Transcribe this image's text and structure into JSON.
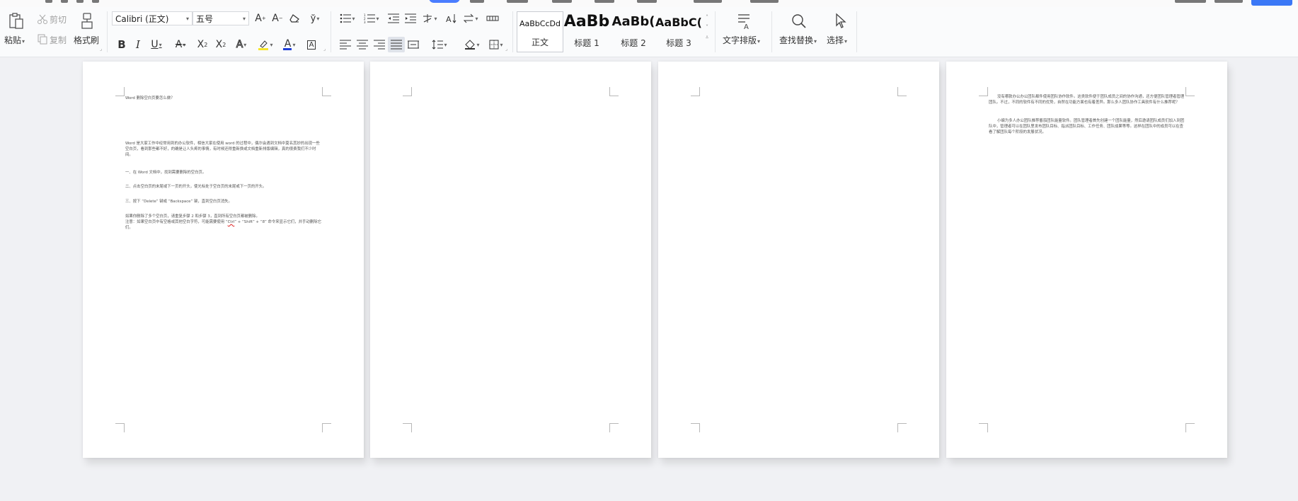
{
  "ribbon": {
    "clipboard": {
      "paste": "粘贴",
      "cut": "剪切",
      "copy": "复制",
      "format_painter": "格式刷"
    },
    "font": {
      "family": "Calibri (正文)",
      "size": "五号"
    },
    "styles": [
      {
        "preview": "AaBbCcDd",
        "name": "正文"
      },
      {
        "preview": "AaBb",
        "name": "标题 1"
      },
      {
        "preview": "AaBb(",
        "name": "标题 2"
      },
      {
        "preview": "AaBbC(",
        "name": "标题 3"
      }
    ],
    "text_layout": "文字排版",
    "find_replace": "查找替换",
    "select": "选择"
  },
  "pages": {
    "p1": {
      "title": "Word 删除空白页要怎么做？",
      "intro": "Word 是大家工作中经常用到的办公软件，相信大家在使用 word 的过程中，偶尔会遇到文档中莫名其妙的出现一些空白页，看到那些都不好，的确是让人头疼的事情，有时候还得重新换或文档重新排版编辑，真的很费我们不少时间。",
      "step1": "一、在 Word 文档中，找到需要删除的空白页。",
      "step2": "二、点击空白页的末尾或下一页的开头，使光标处于空白页的末尾或下一页的开头。",
      "step3": "三、按下 “Delete” 键或 “Backspace” 键，直到空白页消失。",
      "note1": "如果你删除了多个空白页，请重复步骤 2 和步骤 3，直到所有空白页都被删除。",
      "note2_a": "注意：如果空白页中有空格或其他空白字符，可能需要使用 “",
      "note2_ctrl": "Ctrl",
      "note2_b": "” + “Shift” + “8” 命令来显示它们，并手动删除它们。"
    },
    "p4": {
      "para1": "没有哪款办公办公团队都件使用团队协作软件。这类软件便于团队成员之间的协作沟通，还方便团队管理者管理团队。不过，不同的软件有不同的优势，自然在功能方面也有着差异。那么多人团队协作工具软件有什么推荐呢？",
      "para2": "小编为多人办公团队推荐番茄团队能量软件。团队管理者首先创建一个团队能量，然后邀请团队成员们加入到团队中，管理者可以在团队里发布团队目标、指派团队目标、工作任务、团队成果等等。这样在团队中的成员可以在查看了解团队每个阶段的发展状况。"
    }
  }
}
